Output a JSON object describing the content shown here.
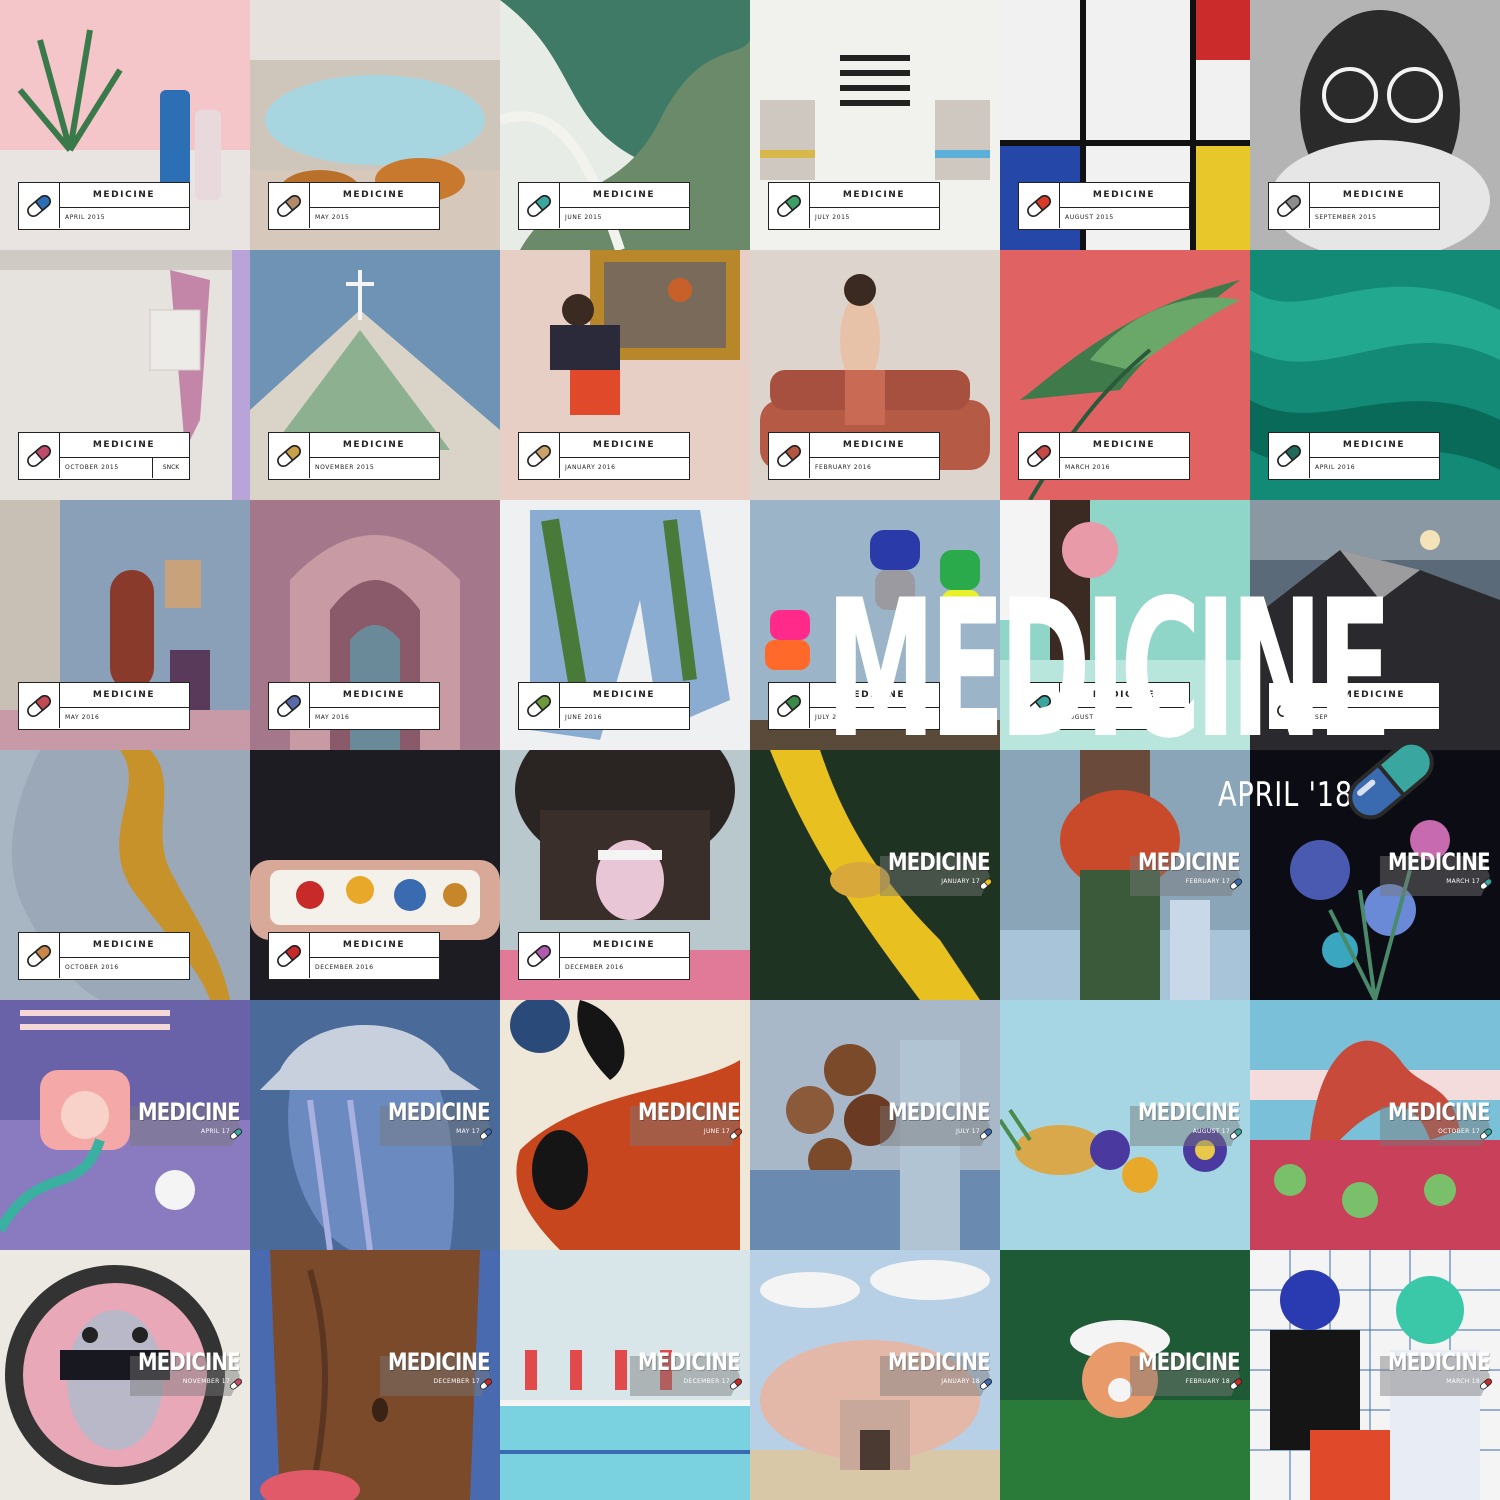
{
  "brand": "MEDICINE",
  "overlay": {
    "word": "MEDICINE",
    "date": "APRIL '18"
  },
  "tiles": [
    {
      "date": "APRIL 2015",
      "style": "classic",
      "pill": "#2d6fb5",
      "bg": "#f4c6c9",
      "art": "plant"
    },
    {
      "date": "MAY 2015",
      "style": "classic",
      "pill": "#b08a6a",
      "bg": "#cfc6bb",
      "art": "pool"
    },
    {
      "date": "JUNE 2015",
      "style": "classic",
      "pill": "#3aa6a0",
      "bg": "#e8ece6",
      "art": "marble"
    },
    {
      "date": "JULY 2015",
      "style": "classic",
      "pill": "#3d9e66",
      "bg": "#f1f1ee",
      "art": "stripes"
    },
    {
      "date": "AUGUST 2015",
      "style": "classic",
      "pill": "#d93b2b",
      "bg": "#f2f2f2",
      "art": "mondrian"
    },
    {
      "date": "SEPTEMBER 2015",
      "style": "classic",
      "pill": "#8c8c8c",
      "bg": "#9a9a9a",
      "art": "portrait"
    },
    {
      "date": "OCTOBER 2015",
      "extra": "SNCK",
      "style": "classic",
      "pill": "#c04a6a",
      "bg": "#e6e3df",
      "art": "shorts"
    },
    {
      "date": "NOVEMBER 2015",
      "style": "classic",
      "pill": "#c8a24a",
      "bg": "#6f93b5",
      "art": "hill"
    },
    {
      "date": "JANUARY 2016",
      "style": "classic",
      "pill": "#caa36a",
      "bg": "#e7cfc6",
      "art": "jump"
    },
    {
      "date": "FEBRUARY 2016",
      "style": "classic",
      "pill": "#b5563f",
      "bg": "#dcd4cd",
      "art": "sofa"
    },
    {
      "date": "MARCH 2016",
      "style": "classic",
      "pill": "#c84848",
      "bg": "#e06262",
      "art": "leaf"
    },
    {
      "date": "APRIL 2016",
      "style": "classic",
      "pill": "#1f6a5a",
      "bg": "#1a8a7a",
      "art": "silk"
    },
    {
      "date": "MAY 2016",
      "style": "classic",
      "pill": "#c24a55",
      "bg": "#8aa0b8",
      "art": "room"
    },
    {
      "date": "MAY 2016",
      "style": "classic",
      "pill": "#5a6aa8",
      "bg": "#a4788a",
      "art": "arch"
    },
    {
      "date": "JUNE 2016",
      "style": "classic",
      "pill": "#6a9a3a",
      "bg": "#eef0f2",
      "art": "denim"
    },
    {
      "date": "JULY 2016",
      "style": "classic",
      "pill": "#3a8a4a",
      "bg": "#9bb4c8",
      "art": "rocks"
    },
    {
      "date": "AUGUST 2016",
      "style": "classic",
      "pill": "#3aa6a0",
      "bg": "#8fd6c8",
      "art": "ball"
    },
    {
      "date": "SEPTEMBER 2016",
      "style": "classic",
      "pill": "#3a4a8a",
      "bg": "#5a6a78",
      "art": "volcano"
    },
    {
      "date": "OCTOBER 2016",
      "style": "classic",
      "pill": "#c8864a",
      "bg": "#a8b6c4",
      "art": "face"
    },
    {
      "date": "DECEMBER 2016",
      "style": "classic",
      "pill": "#c82a2a",
      "bg": "#1c1c22",
      "art": "space"
    },
    {
      "date": "DECEMBER 2016",
      "style": "classic",
      "pill": "#b05ab0",
      "bg": "#b8c8cc",
      "art": "tongue"
    },
    {
      "date": "JANUARY 17",
      "style": "new",
      "pill": "#e8c020",
      "bg": "#1f3322",
      "art": "slide"
    },
    {
      "date": "FEBRUARY 17",
      "style": "new",
      "pill": "#3a6ab0",
      "bg": "#8aa4b8",
      "art": "flowers"
    },
    {
      "date": "MARCH 17",
      "style": "new",
      "pill": "#3aa6a0",
      "bg": "#0c0c14",
      "art": "bouquet"
    },
    {
      "date": "APRIL 17",
      "style": "new",
      "pill": "#3aa6a0",
      "bg": "#6a62a8",
      "art": "phone"
    },
    {
      "date": "MAY 17",
      "style": "new",
      "pill": "#3a6ab0",
      "bg": "#4a6a9a",
      "art": "hat"
    },
    {
      "date": "JUNE 17",
      "style": "new",
      "pill": "#c84a2a",
      "bg": "#efe8d8",
      "art": "shapes"
    },
    {
      "date": "JULY 17",
      "style": "new",
      "pill": "#3a6ab0",
      "bg": "#a8b8c8",
      "art": "heads"
    },
    {
      "date": "AUGUST 17",
      "style": "new",
      "pill": "#3aa6a0",
      "bg": "#a6d6e4",
      "art": "pineapple"
    },
    {
      "date": "OCTOBER 17",
      "style": "new",
      "pill": "#3aa6a0",
      "bg": "#7ac0d8",
      "art": "rockarch"
    },
    {
      "date": "NOVEMBER 17",
      "style": "new",
      "pill": "#c84a6a",
      "bg": "#ece8e2",
      "art": "girl"
    },
    {
      "date": "DECEMBER 17",
      "style": "new",
      "pill": "#c82a2a",
      "bg": "#4a6ab0",
      "art": "belly"
    },
    {
      "date": "DECEMBER 17",
      "style": "new",
      "pill": "#c82a2a",
      "bg": "#d8e6ea",
      "art": "swimmers"
    },
    {
      "date": "JANUARY 18",
      "style": "new",
      "pill": "#3a6ab0",
      "bg": "#b8d0e6",
      "art": "shell"
    },
    {
      "date": "FEBRUARY 18",
      "style": "new",
      "pill": "#c82a2a",
      "bg": "#1f5a36",
      "art": "visor"
    },
    {
      "date": "MARCH 18",
      "style": "new",
      "pill": "#c82a2a",
      "bg": "#f4f4f4",
      "art": "couple"
    }
  ]
}
